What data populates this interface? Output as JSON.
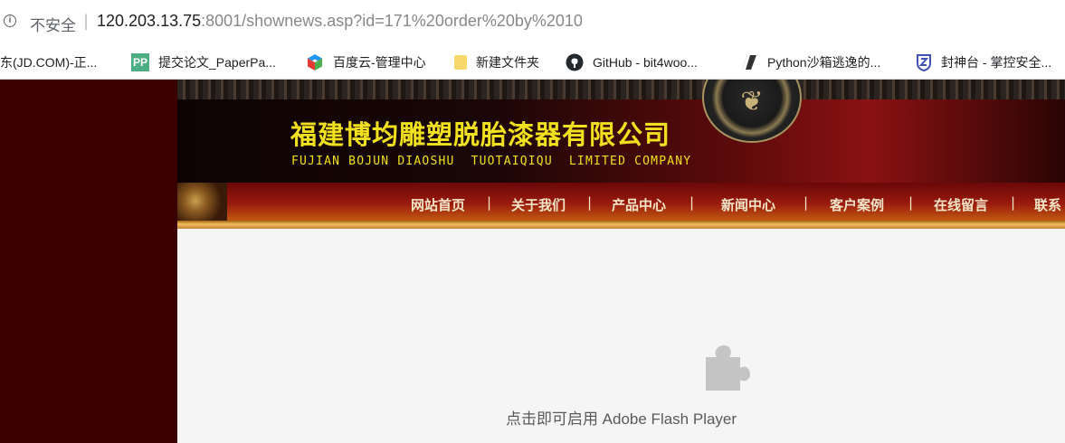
{
  "browser": {
    "security_label": "不安全",
    "separator": "|",
    "url_host": "120.203.13.75",
    "url_rest": ":8001/shownews.asp?id=171%20order%20by%2010"
  },
  "bookmarks": [
    {
      "label": "东(JD.COM)-正...",
      "icon": "none"
    },
    {
      "label": "提交论文_PaperPa...",
      "icon": "pp-icon",
      "icon_text": "PP"
    },
    {
      "label": "百度云-管理中心",
      "icon": "cube-icon"
    },
    {
      "label": "新建文件夹",
      "icon": "folder-icon"
    },
    {
      "label": "GitHub - bit4woo...",
      "icon": "github-icon"
    },
    {
      "label": "Python沙箱逃逸的...",
      "icon": "python-icon"
    },
    {
      "label": "封神台 - 掌控安全...",
      "icon": "shield-icon"
    }
  ],
  "site": {
    "company_cn": "福建博均雕塑脱胎漆器有限公司",
    "company_en": "FUJIAN BOJUN DIAOSHU  TUOTAIQIQU  LIMITED COMPANY",
    "nav": [
      "网站首页",
      "关于我们",
      "产品中心",
      "新闻中心",
      "客户案例",
      "在线留言",
      "联系"
    ],
    "nav_separator": "|"
  },
  "plugin": {
    "message": "点击即可启用 Adobe Flash Player"
  },
  "colors": {
    "left_panel": "#3a0000",
    "title_yellow": "#f0e020",
    "plugin_bg": "#f5f5f5"
  }
}
